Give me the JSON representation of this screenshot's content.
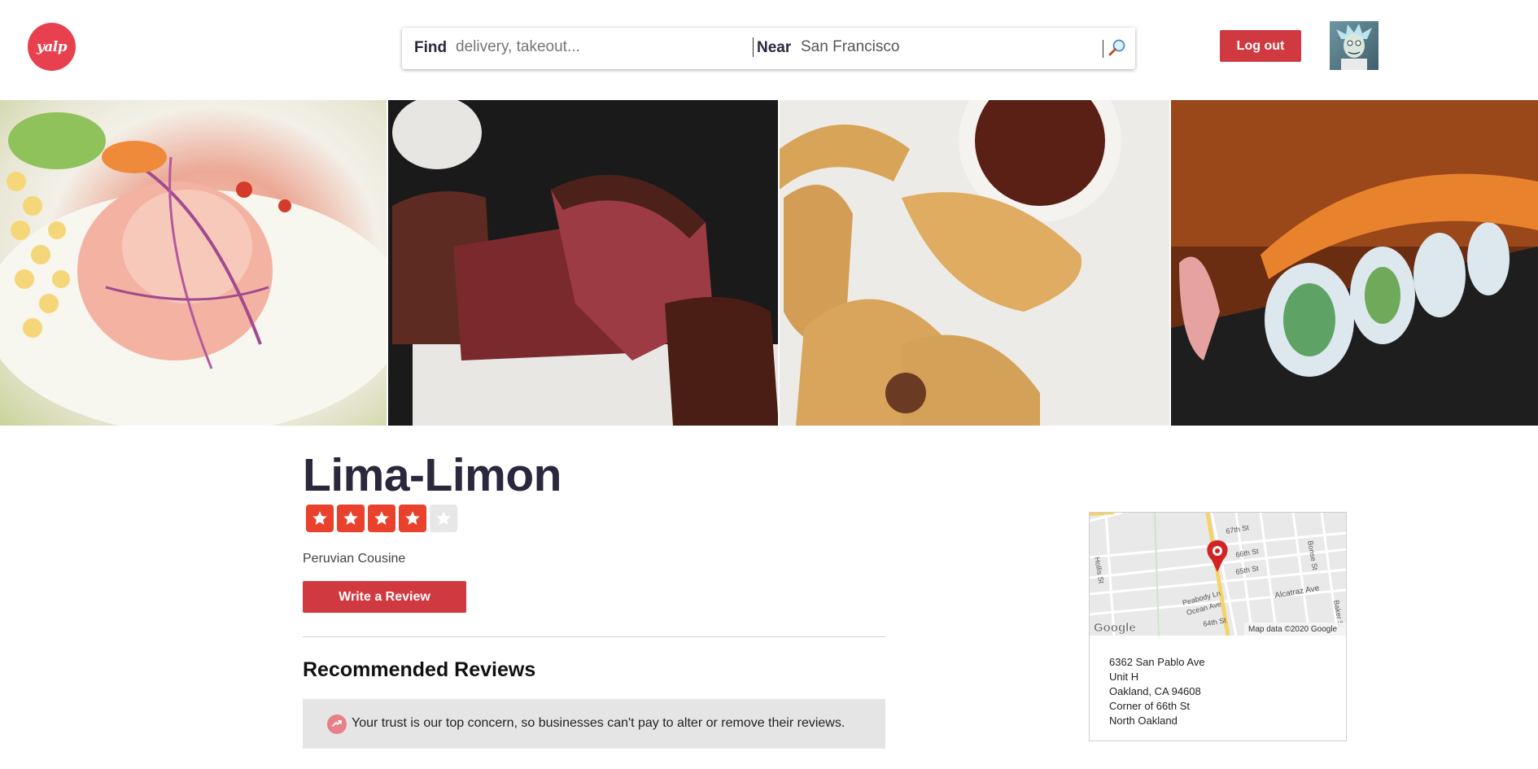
{
  "header": {
    "logo_text": "yalp",
    "search": {
      "find_label": "Find",
      "find_placeholder": "delivery, takeout...",
      "near_label": "Near",
      "near_value": "San Francisco"
    },
    "logout_label": "Log out"
  },
  "photos": [
    {
      "alt": "ceviche-photo"
    },
    {
      "alt": "steak-photo"
    },
    {
      "alt": "empanadas-photo"
    },
    {
      "alt": "sushi-photo"
    }
  ],
  "business": {
    "name": "Lima-Limon",
    "rating": 4,
    "rating_max": 5,
    "category": "Peruvian Cousine",
    "write_review_label": "Write a Review"
  },
  "reviews": {
    "heading": "Recommended Reviews",
    "trust_notice": "Your trust is our top concern, so businesses can't pay to alter or remove their reviews."
  },
  "map": {
    "streets": [
      "67th St",
      "66th St",
      "65th St",
      "Hollis St",
      "Bonse St",
      "Alcatraz Ave",
      "Peabody Ln",
      "Ocean Ave",
      "64th St",
      "Baker St"
    ],
    "google_label": "Google",
    "attribution": "Map data ©2020 Google",
    "address_lines": [
      "6362 San Pablo Ave",
      "Unit H",
      "Oakland, CA 94608",
      "Corner of 66th St",
      "North Oakland"
    ]
  },
  "colors": {
    "brand_red": "#d0393f",
    "star_red": "#e9412c"
  }
}
